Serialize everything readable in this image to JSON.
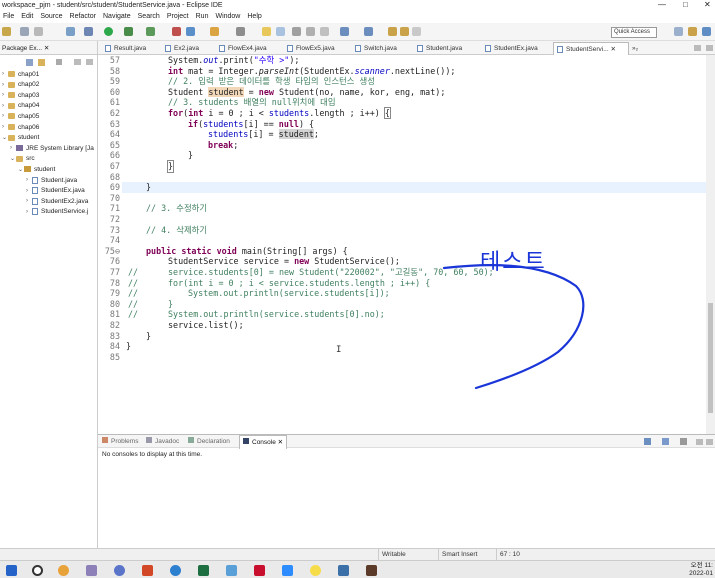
{
  "window": {
    "title": "workspace_pjm - student/src/student/StudentService.java - Eclipse IDE",
    "controls": [
      "—",
      "□",
      "✕"
    ]
  },
  "menu": [
    "File",
    "Edit",
    "Source",
    "Refactor",
    "Navigate",
    "Search",
    "Project",
    "Run",
    "Window",
    "Help"
  ],
  "toolbar": {
    "quick_access": "Quick Access"
  },
  "package_explorer": {
    "title": "Package Ex... ✕",
    "items": [
      {
        "label": "chap01",
        "indent": 0,
        "icon": "folder",
        "arrow": "›"
      },
      {
        "label": "chap02",
        "indent": 0,
        "icon": "folder",
        "arrow": "›"
      },
      {
        "label": "chap03",
        "indent": 0,
        "icon": "folder",
        "arrow": "›"
      },
      {
        "label": "chap04",
        "indent": 0,
        "icon": "folder",
        "arrow": "›"
      },
      {
        "label": "chap05",
        "indent": 0,
        "icon": "folder",
        "arrow": "›"
      },
      {
        "label": "chap06",
        "indent": 0,
        "icon": "folder",
        "arrow": "›"
      },
      {
        "label": "student",
        "indent": 0,
        "icon": "folder",
        "arrow": "⌄"
      },
      {
        "label": "JRE System Library [Ja",
        "indent": 1,
        "icon": "lib",
        "arrow": "›"
      },
      {
        "label": "src",
        "indent": 1,
        "icon": "folder",
        "arrow": "⌄"
      },
      {
        "label": "student",
        "indent": 2,
        "icon": "pkg",
        "arrow": "⌄"
      },
      {
        "label": "Student.java",
        "indent": 3,
        "icon": "java",
        "arrow": "›"
      },
      {
        "label": "StudentEx.java",
        "indent": 3,
        "icon": "java",
        "arrow": "›"
      },
      {
        "label": "StudentEx2.java",
        "indent": 3,
        "icon": "java",
        "arrow": "›"
      },
      {
        "label": "StudentService.j",
        "indent": 3,
        "icon": "java",
        "arrow": "›"
      }
    ]
  },
  "editor_tabs": [
    {
      "label": "Result.java"
    },
    {
      "label": "Ex2.java"
    },
    {
      "label": "FlowEx4.java"
    },
    {
      "label": "FlowEx5.java"
    },
    {
      "label": "Switch.java"
    },
    {
      "label": "Student.java"
    },
    {
      "label": "StudentEx.java"
    },
    {
      "label": "StudentServi... ✕",
      "active": true
    },
    {
      "label": "»₂"
    }
  ],
  "code_lines": [
    {
      "n": "57",
      "c": ""
    },
    {
      "n": "58",
      "c": ""
    },
    {
      "n": "59",
      "c": ""
    },
    {
      "n": "60",
      "c": ""
    },
    {
      "n": "61",
      "c": ""
    },
    {
      "n": "62",
      "c": ""
    },
    {
      "n": "63",
      "c": ""
    },
    {
      "n": "64",
      "c": ""
    },
    {
      "n": "65",
      "c": ""
    },
    {
      "n": "66",
      "c": ""
    },
    {
      "n": "67",
      "c": ""
    },
    {
      "n": "68",
      "c": ""
    },
    {
      "n": "69",
      "c": ""
    },
    {
      "n": "70",
      "c": ""
    },
    {
      "n": "71",
      "c": ""
    },
    {
      "n": "72",
      "c": ""
    },
    {
      "n": "73",
      "c": ""
    },
    {
      "n": "74",
      "c": ""
    },
    {
      "n": "75⊖",
      "c": ""
    },
    {
      "n": "76",
      "c": ""
    },
    {
      "n": "77",
      "c": "//"
    },
    {
      "n": "78",
      "c": "//"
    },
    {
      "n": "79",
      "c": "//"
    },
    {
      "n": "80",
      "c": "//"
    },
    {
      "n": "81",
      "c": "//"
    },
    {
      "n": "82",
      "c": ""
    },
    {
      "n": "83",
      "c": ""
    },
    {
      "n": "84",
      "c": ""
    },
    {
      "n": "85",
      "c": ""
    }
  ],
  "code_text": {
    "l57a": "System.",
    "l57b": "out",
    "l57c": ".print(",
    "l57d": "\"수학 >\"",
    "l57e": ");",
    "l58a": "int",
    "l58b": " mat = Integer.",
    "l58c": "parseInt",
    "l58d": "(StudentEx.",
    "l58e": "scanner",
    "l58f": ".nextLine());",
    "l59": "// 2. 입력 받은 데이터를 학생 타입의 인스턴스 생성",
    "l60a": "Student ",
    "l60b": "student",
    "l60c": " = ",
    "l60d": "new",
    "l60e": " Student(no, name, kor, eng, mat);",
    "l61": "// 3. students 배열의 null위치에 대입",
    "l62a": "for",
    "l62b": "(",
    "l62c": "int",
    "l62d": " i = 0 ; i < ",
    "l62e": "students",
    "l62f": ".length ; i++) ",
    "l62g": "{",
    "l63a": "if",
    "l63b": "(",
    "l63c": "students",
    "l63d": "[i] == ",
    "l63e": "null",
    "l63f": ") {",
    "l64a": "students",
    "l64b": "[i] = ",
    "l64c": "student",
    "l64d": ";",
    "l65a": "break",
    "l65b": ";",
    "l66": "}",
    "l67": "}",
    "l69": "}",
    "l71": "// 3. 수정하기",
    "l73": "// 4. 삭제하기",
    "l75a": "public",
    "l75b": " ",
    "l75c": "static",
    "l75d": " ",
    "l75e": "void",
    "l75f": " main(String[] args) {",
    "l76a": "StudentService service = ",
    "l76b": "new",
    "l76c": " StudentService();",
    "l77a": "service.",
    "l77b": "students",
    "l77c": "[0] = ",
    "l77d": "new",
    "l77e": " Student(",
    "l77f": "\"220002\"",
    "l77g": ", ",
    "l77h": "\"고길동\"",
    "l77i": ", 70, 60, 50);",
    "l78a": "for",
    "l78b": "(",
    "l78c": "int",
    "l78d": " i = 0 ; i < service.",
    "l78e": "students",
    "l78f": ".length ; i++) {",
    "l79a": "System.",
    "l79b": "out",
    "l79c": ".println(service.",
    "l79d": "students",
    "l79e": "[i]);",
    "l80": "}",
    "l81a": "System.",
    "l81b": "out",
    "l81c": ".println(service.",
    "l81d": "students",
    "l81e": "[0].",
    "l81f": "no",
    "l81g": ");",
    "l82": "service.list();",
    "l83": "}",
    "l84": "}"
  },
  "annotation": {
    "text": "테스트",
    "color": "#1a35d8"
  },
  "console": {
    "tabs": [
      "Problems",
      "Javadoc",
      "Declaration",
      "Console ✕"
    ],
    "message": "No consoles to display at this time."
  },
  "statusbar": {
    "mode": "Writable",
    "insert": "Smart Insert",
    "position": "67 : 10"
  },
  "taskbar": {
    "time": "오전 11:",
    "date": "2022-01"
  },
  "colors": {
    "keyword": "#7f0055",
    "string": "#2a00ff",
    "comment": "#3f7f5f",
    "field": "#0000c0",
    "annotation": "#1a35d8"
  }
}
